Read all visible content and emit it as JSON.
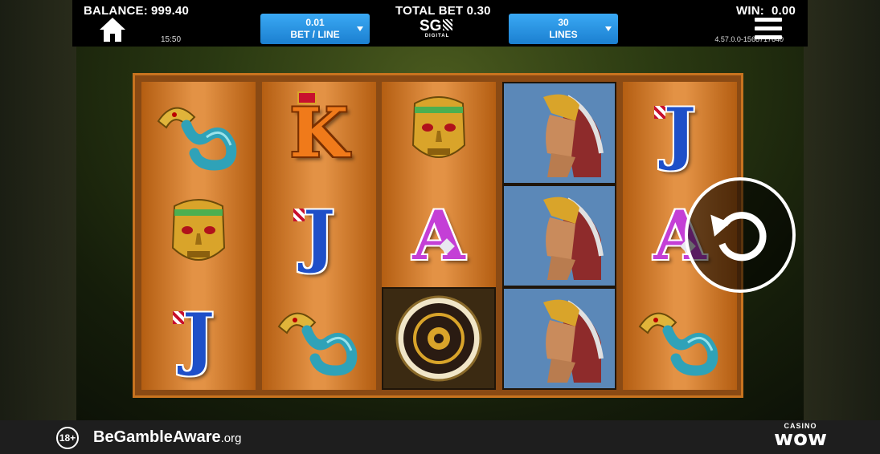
{
  "topbar": {
    "balance_label": "BALANCE:",
    "balance_value": "999.40",
    "clock": "15:50",
    "bet_per_line": {
      "value": "0.01",
      "label": "BET / LINE"
    },
    "total_bet": "TOTAL BET 0.30",
    "provider_logo": "SG",
    "provider_sub": "DIGITAL",
    "lines": {
      "value": "30",
      "label": "LINES"
    },
    "win_label": "WIN:",
    "win_value": "0.00",
    "version": "4.57.0.0-1568717640"
  },
  "reels": [
    [
      "serpent",
      "mask",
      "J"
    ],
    [
      "K",
      "J",
      "serpent"
    ],
    [
      "mask",
      "A",
      "calendar"
    ],
    [
      "warrior",
      "warrior",
      "warrior"
    ],
    [
      "J",
      "A",
      "serpent"
    ]
  ],
  "colors": {
    "accent": "#2a92e4",
    "reel": "#e39245",
    "frame": "#c8731f"
  },
  "footer": {
    "age_badge": "18+",
    "gamble_be": "BeGamble",
    "gamble_aware": "Aware",
    "gamble_org": ".org",
    "brand_top": "CASINO",
    "brand_main": "wow"
  }
}
